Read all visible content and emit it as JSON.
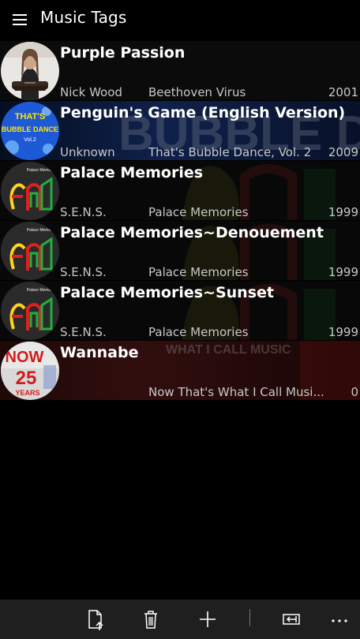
{
  "app": {
    "title": "Music Tags"
  },
  "songs": [
    {
      "title": "Purple Passion",
      "artist": "Nick Wood",
      "album": "Beethoven Virus",
      "year": "2001",
      "art": "woman-portrait"
    },
    {
      "title": "Penguin's Game (English Version)",
      "artist": "Unknown",
      "album": "That's Bubble Dance, Vol. 2",
      "year": "2009",
      "art": "bubble-dance-cover",
      "art_text": [
        "THAT'S",
        "BUBBLE DANCE",
        "Vol.2"
      ]
    },
    {
      "title": "Palace Memories",
      "artist": "S.E.N.S.",
      "album": "Palace Memories",
      "year": "1999",
      "art": "palace-memories-cover"
    },
    {
      "title": "Palace Memories~Denouement",
      "artist": "S.E.N.S.",
      "album": "Palace Memories",
      "year": "1999",
      "art": "palace-memories-cover"
    },
    {
      "title": "Palace Memories~Sunset",
      "artist": "S.E.N.S.",
      "album": "Palace Memories",
      "year": "1999",
      "art": "palace-memories-cover"
    },
    {
      "title": "Wannabe",
      "artist": "",
      "album": "Now That's What I Call Musi...",
      "year": "0",
      "art": "now-25-years-cover",
      "art_text": [
        "NOW",
        "25",
        "YEARS"
      ],
      "bg_text": "WHAT I CALL MUSIC"
    }
  ],
  "palace_art_text": "Palace Memories",
  "appbar": {
    "icons": [
      "import-file-icon",
      "delete-icon",
      "add-icon",
      "back-to-window-icon",
      "more-icon"
    ]
  },
  "colors": {
    "background": "#000000",
    "appbar": "#1f1f1f",
    "subtext": "#c8c8c8"
  }
}
